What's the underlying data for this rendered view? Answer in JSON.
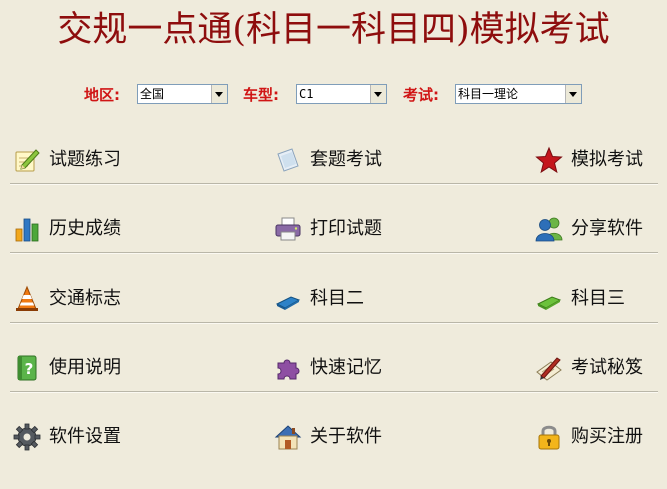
{
  "title": "交规一点通(科目一科目四)模拟考试",
  "filters": {
    "region_label": "地区:",
    "region_value": "全国",
    "vehicle_label": "车型:",
    "vehicle_value": "C1",
    "exam_label": "考试:",
    "exam_value": "科目一理论"
  },
  "menu": {
    "r1": {
      "a": "试题练习",
      "b": "套题考试",
      "c": "模拟考试"
    },
    "r2": {
      "a": "历史成绩",
      "b": "打印试题",
      "c": "分享软件"
    },
    "r3": {
      "a": "交通标志",
      "b": "科目二",
      "c": "科目三"
    },
    "r4": {
      "a": "使用说明",
      "b": "快速记忆",
      "c": "考试秘笈"
    },
    "r5": {
      "a": "软件设置",
      "b": "关于软件",
      "c": "购买注册"
    }
  },
  "icons": {
    "r1": [
      "pencil-notepad-icon",
      "document-icon",
      "star-icon"
    ],
    "r2": [
      "bar-chart-icon",
      "printer-icon",
      "users-icon"
    ],
    "r3": [
      "traffic-cone-icon",
      "blue-eraser-icon",
      "green-eraser-icon"
    ],
    "r4": [
      "help-book-icon",
      "puzzle-icon",
      "pen-note-icon"
    ],
    "r5": [
      "gear-icon",
      "house-icon",
      "lock-icon"
    ]
  },
  "colors": {
    "background": "#efebdc",
    "title": "#8e0d0d",
    "filter_label": "#d01515"
  }
}
